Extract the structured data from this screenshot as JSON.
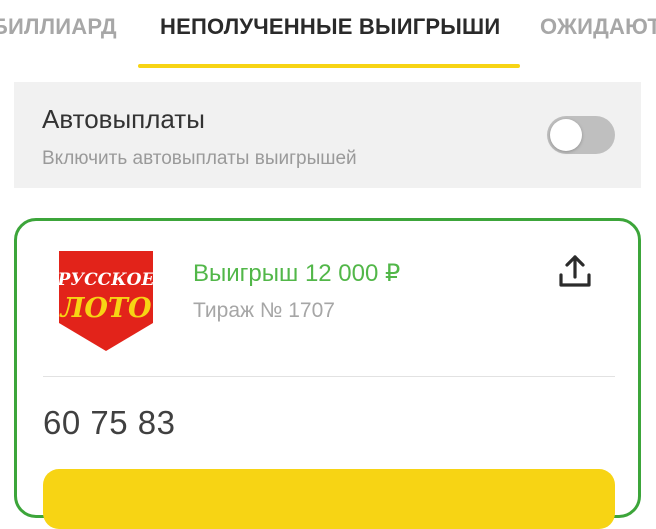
{
  "tabs": [
    {
      "label": "БИЛЛИАРД",
      "active": false
    },
    {
      "label": "НЕПОЛУЧЕННЫЕ ВЫИГРЫШИ",
      "active": true
    },
    {
      "label": "ОЖИДАЮТ",
      "active": false
    }
  ],
  "autopay": {
    "title": "Автовыплаты",
    "subtitle": "Включить автовыплаты выигрышей",
    "enabled": false
  },
  "ticket": {
    "logo_text_line1": "РУССКОЕ",
    "logo_text_line2": "ЛОТО",
    "prize": "Выигрыш 12 000 ₽",
    "draw": "Тираж № 1707",
    "numbers": "60 75 83"
  },
  "icons": {
    "share": "share-upload-icon",
    "logo": "russkoe-loto-logo"
  },
  "colors": {
    "accent_yellow": "#f7d414",
    "win_green": "#52b749",
    "card_border": "#3ca53a",
    "logo_red": "#e2231a"
  }
}
